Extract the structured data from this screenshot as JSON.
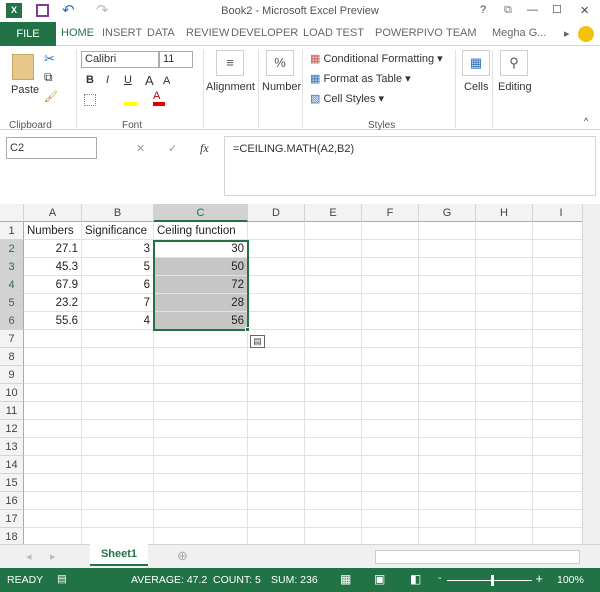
{
  "window": {
    "title": "Book2 - Microsoft Excel Preview",
    "help": "?",
    "restore": "⧉",
    "minimize": "—",
    "maximize": "☐",
    "close": "✕"
  },
  "tabs": [
    "FILE",
    "HOME",
    "INSERT",
    "DATA",
    "REVIEW",
    "DEVELOPER",
    "LOAD TEST",
    "POWERPIVO",
    "TEAM"
  ],
  "user": "Megha G...",
  "ribbon": {
    "clipboard": {
      "paste": "Paste",
      "label": "Clipboard"
    },
    "font": {
      "name": "Calibri",
      "size": "11",
      "bold": "B",
      "italic": "I",
      "underline": "U",
      "grow": "A",
      "shrink": "A",
      "color": "A",
      "label": "Font"
    },
    "alignment": "Alignment",
    "number": "Number",
    "percent": "%",
    "styles": {
      "conditional": "Conditional Formatting",
      "table": "Format as Table",
      "cell": "Cell Styles",
      "label": "Styles"
    },
    "cells": "Cells",
    "editing": "Editing"
  },
  "formula_bar": {
    "name_box": "C2",
    "cancel": "✕",
    "enter": "✓",
    "fx": "fx",
    "formula": "=CEILING.MATH(A2,B2)"
  },
  "columns": [
    "A",
    "B",
    "C",
    "D",
    "E",
    "F",
    "G",
    "H",
    "I"
  ],
  "rows": [
    "1",
    "2",
    "3",
    "4",
    "5",
    "6",
    "7",
    "8",
    "9",
    "10",
    "11",
    "12",
    "13",
    "14",
    "15",
    "16",
    "17",
    "18"
  ],
  "cells": {
    "header": [
      "Numbers",
      "Significance",
      "Ceiling function"
    ],
    "data": [
      [
        "27.1",
        "3",
        "30"
      ],
      [
        "45.3",
        "5",
        "50"
      ],
      [
        "67.9",
        "6",
        "72"
      ],
      [
        "23.2",
        "7",
        "28"
      ],
      [
        "55.6",
        "4",
        "56"
      ]
    ]
  },
  "sheet_tab": "Sheet1",
  "status": {
    "ready": "READY",
    "average": "AVERAGE: 47.2",
    "count": "COUNT: 5",
    "sum": "SUM: 236",
    "zoom": "100%"
  },
  "colors": {
    "accent": "#217346"
  }
}
